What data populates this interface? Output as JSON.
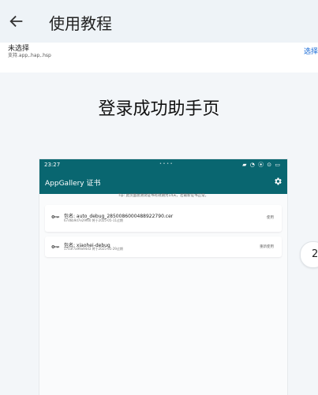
{
  "header": {
    "title": "使用教程"
  },
  "file": {
    "selected": "未选择",
    "hint": "支持.app,.hap,.hsp",
    "action": "选择"
  },
  "content": {
    "title": "登录成功助手页"
  },
  "phone": {
    "time": "23:27",
    "status_mid": "• • • •",
    "status_icons": "▰ ◔ ⦿ ⊙ ▭",
    "app_title": "AppGallery 证书",
    "tip": "Tip: 此页面总测试证书有效期为14天，若最新证书正常。",
    "certs": [
      {
        "name": "包名: auto_debug_2850086000488922790.cer",
        "meta": "67d6b9d7e29f60 将于2025-05-11过期",
        "action": "使用"
      },
      {
        "name": "包名: xiaohei-debug",
        "meta": "5703f7a99a94d3 将于2025-05-29过期",
        "action": "重新使用"
      }
    ]
  },
  "page": {
    "number": "2"
  },
  "colors": {
    "teal": "#096670",
    "link": "#1769d6"
  },
  "icons": {
    "back": "arrow-left-icon",
    "gear": "gear-icon",
    "key": "key-icon"
  }
}
